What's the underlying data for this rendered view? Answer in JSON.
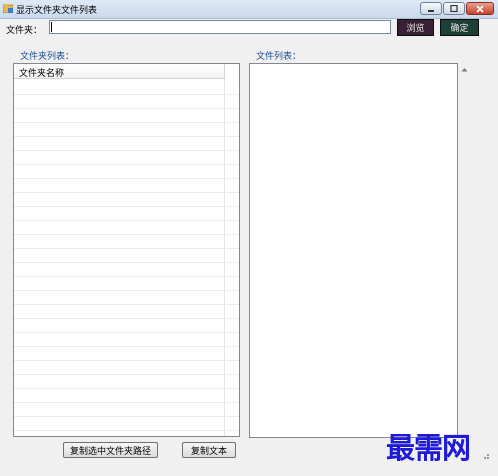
{
  "window": {
    "title": "显示文件夹文件列表",
    "icon": "app-icon"
  },
  "toolbar": {
    "folder_label": "文件夹：",
    "folder_value": "",
    "browse_label": "浏览",
    "confirm_label": "确定"
  },
  "left_panel": {
    "label": "文件夹列表：",
    "column_header": "文件夹名称",
    "rows": []
  },
  "right_panel": {
    "label": "文件列表：",
    "text": ""
  },
  "buttons": {
    "copy_path_label": "复制选中文件夹路径",
    "copy_text_label": "复制文本"
  },
  "watermark": {
    "text": "最需网"
  },
  "colors": {
    "browse_bg": "#3a2036",
    "confirm_bg": "#1c4036",
    "label_blue": "#1a4b8c",
    "watermark": "#1e1ad8"
  }
}
